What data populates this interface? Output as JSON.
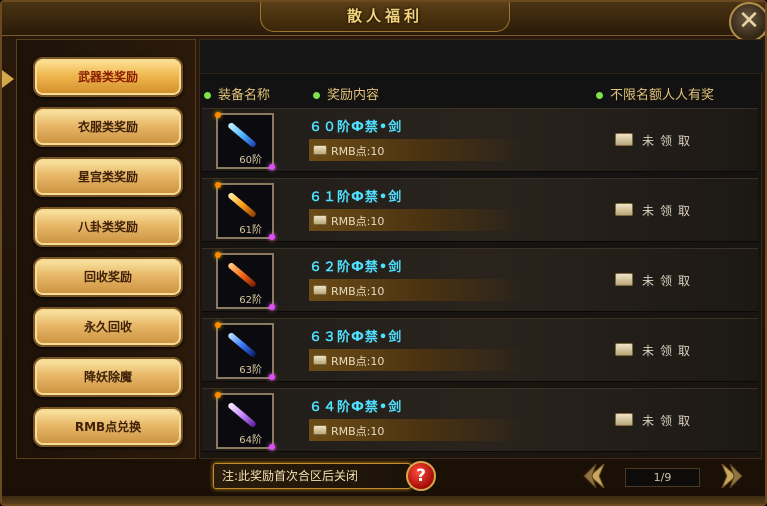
{
  "window": {
    "title": "散人福利"
  },
  "menu": {
    "items": [
      {
        "label": "武器类奖励",
        "active": true
      },
      {
        "label": "衣服类奖励",
        "active": false
      },
      {
        "label": "星宫类奖励",
        "active": false
      },
      {
        "label": "八卦类奖励",
        "active": false
      },
      {
        "label": "回收奖励",
        "active": false
      },
      {
        "label": "永久回收",
        "active": false
      },
      {
        "label": "降妖除魔",
        "active": false
      },
      {
        "label": "RMB点兑换",
        "active": false
      }
    ]
  },
  "columns": {
    "equipment": "装备名称",
    "reward": "奖励内容",
    "quota": "不限名额人人有奖"
  },
  "rewards": [
    {
      "level": "60阶",
      "name": "６０阶Ф禁•剑",
      "rmb": "RMB点:10",
      "status": "未领取",
      "weapon_color": "#4fb8ff"
    },
    {
      "level": "61阶",
      "name": "６１阶Ф禁•剑",
      "rmb": "RMB点:10",
      "status": "未领取",
      "weapon_color": "#ffa21a"
    },
    {
      "level": "62阶",
      "name": "６２阶Ф禁•剑",
      "rmb": "RMB点:10",
      "status": "未领取",
      "weapon_color": "#ff6a1a"
    },
    {
      "level": "63阶",
      "name": "６３阶Ф禁•剑",
      "rmb": "RMB点:10",
      "status": "未领取",
      "weapon_color": "#3a7bff"
    },
    {
      "level": "64阶",
      "name": "６４阶Ф禁•剑",
      "rmb": "RMB点:10",
      "status": "未领取",
      "weapon_color": "#c78bff"
    }
  ],
  "footer": {
    "note": "注:此奖励首次合区后关闭",
    "help": "?",
    "page": "1/9"
  },
  "colors": {
    "item_name": "#4fe0ff",
    "header_text": "#e2c277",
    "menu_gold": "#e8b868"
  }
}
